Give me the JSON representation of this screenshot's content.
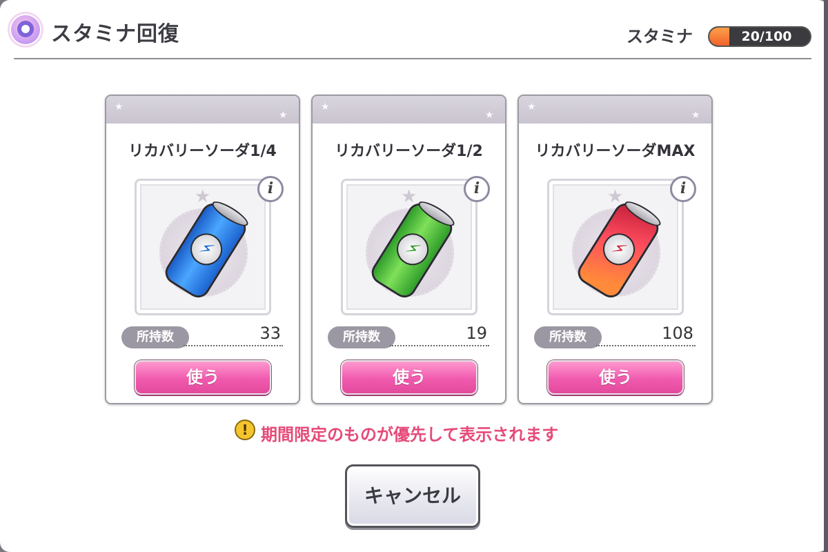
{
  "header": {
    "title": "スタミナ回復",
    "stamina_label": "スタミナ",
    "stamina_value": "20/100",
    "stamina_fraction": 0.2
  },
  "cards": [
    {
      "name": "リカバリーソーダ1/4",
      "held_label": "所持数",
      "held_count": "33",
      "use_label": "使う",
      "can_color": "#2a7ee8",
      "icon": "blue-soda-can-icon"
    },
    {
      "name": "リカバリーソーダ1/2",
      "held_label": "所持数",
      "held_count": "19",
      "use_label": "使う",
      "can_color": "#3fbf3a",
      "icon": "green-soda-can-icon"
    },
    {
      "name": "リカバリーソーダMAX",
      "held_label": "所持数",
      "held_count": "108",
      "use_label": "使う",
      "can_color": "#e0333f",
      "icon": "red-soda-can-icon"
    }
  ],
  "notice": {
    "icon": "!",
    "text": "期間限定のものが優先して表示されます"
  },
  "footer": {
    "cancel_label": "キャンセル"
  },
  "colors": {
    "accent_pink": "#f05aae",
    "notice_red": "#e64a78",
    "stamina_orange": "#f0622a"
  }
}
